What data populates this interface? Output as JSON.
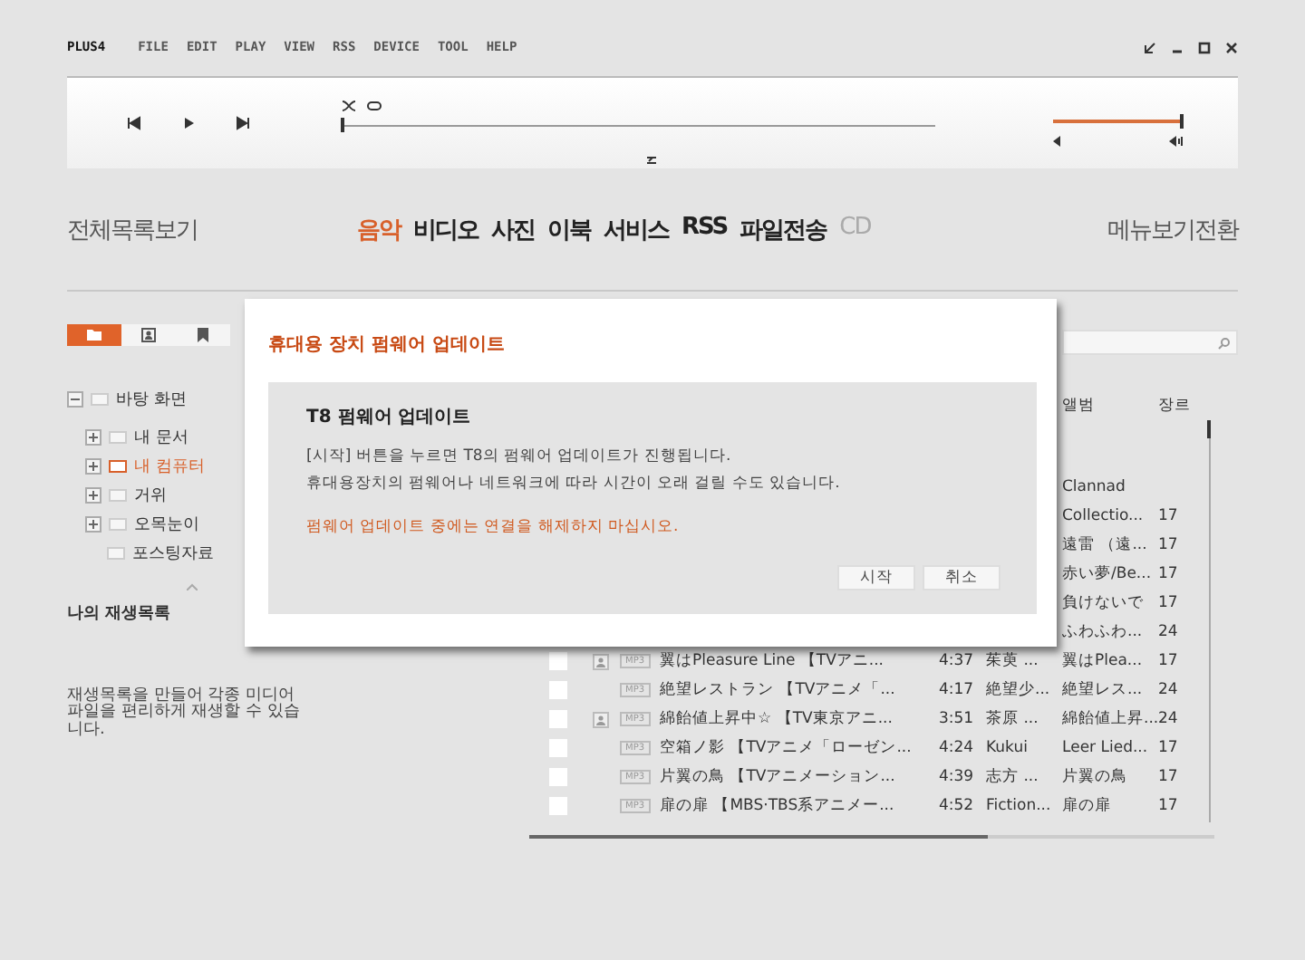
{
  "menu_bar": {
    "logo": "PLUS4",
    "items": [
      "FILE",
      "EDIT",
      "PLAY",
      "VIEW",
      "RSS",
      "DEVICE",
      "TOOL",
      "HELP"
    ]
  },
  "player": {
    "seek": {
      "level": 0
    },
    "volume": {
      "level": 1
    }
  },
  "nav": {
    "left": "전체목록보기",
    "right": "메뉴보기전환",
    "tabs": [
      {
        "label": "음악",
        "selected": true,
        "disabled": false
      },
      {
        "label": "비디오",
        "selected": false,
        "disabled": false
      },
      {
        "label": "사진",
        "selected": false,
        "disabled": false
      },
      {
        "label": "이북",
        "selected": false,
        "disabled": false
      },
      {
        "label": "서비스",
        "selected": false,
        "disabled": false
      },
      {
        "label": "RSS",
        "selected": false,
        "disabled": false
      },
      {
        "label": "파일전송",
        "selected": false,
        "disabled": false
      },
      {
        "label": "CD",
        "selected": false,
        "disabled": true
      }
    ]
  },
  "sidebar": {
    "tabs": [
      {
        "kind": "folder",
        "selected": true
      },
      {
        "kind": "contact",
        "selected": false
      },
      {
        "kind": "bookmark",
        "selected": false
      }
    ],
    "tree": [
      {
        "label": "바탕 화면",
        "expanded": true,
        "selected": false,
        "children": [
          {
            "label": "내 문서",
            "expanded": false,
            "selected": false
          },
          {
            "label": "내 컴퓨터",
            "expanded": false,
            "selected": true
          },
          {
            "label": "거위",
            "expanded": false,
            "selected": false
          },
          {
            "label": "오목눈이",
            "expanded": false,
            "selected": false
          },
          {
            "label": "포스팅자료",
            "selected": false
          }
        ]
      }
    ],
    "playlist_title": "나의 재생목록",
    "playlist_hint": "재생목록을 만들어 각종 미디어 파일을 편리하게 재생할 수 있습니다."
  },
  "table": {
    "columns": [
      "앨범",
      "장르"
    ],
    "rows": [
      {
        "album": "Clannad"
      },
      {
        "album": "Collectio...",
        "genre": "17"
      },
      {
        "album": "遠雷 （遠...",
        "genre": "17"
      },
      {
        "album": "赤い夢/Be...",
        "genre": "17"
      },
      {
        "album": "負けないで",
        "genre": "17"
      },
      {
        "album": "ふわふわ...",
        "genre": "24"
      },
      {
        "checked": false,
        "format": "MP3",
        "person_icon": true,
        "title": "翼はPleasure Line 【TVアニ...",
        "time": "4:37",
        "artist": "茱萸 ...",
        "album": "翼はPlea...",
        "genre": "17"
      },
      {
        "checked": false,
        "format": "MP3",
        "person_icon": false,
        "title": "絶望レストラン 【TVアニメ「...",
        "time": "4:17",
        "artist": "絶望少...",
        "album": "絶望レス...",
        "genre": "24"
      },
      {
        "checked": false,
        "format": "MP3",
        "person_icon": true,
        "title": "綿飴値上昇中☆ 【TV東京アニ...",
        "time": "3:51",
        "artist": "茶原 ...",
        "album": "綿飴値上昇...",
        "genre": "24"
      },
      {
        "checked": false,
        "format": "MP3",
        "person_icon": false,
        "title": "空箱ノ影 【TVアニメ「ローゼン...",
        "time": "4:24",
        "artist": "Kukui",
        "album": "Leer Lied...",
        "genre": "17"
      },
      {
        "checked": false,
        "format": "MP3",
        "person_icon": false,
        "title": "片翼の鳥 【TVアニメーション...",
        "time": "4:39",
        "artist": "志方 ...",
        "album": "片翼の鳥",
        "genre": "17"
      },
      {
        "checked": false,
        "format": "MP3",
        "person_icon": false,
        "title": "扉の扉 【MBS·TBS系アニメー...",
        "time": "4:52",
        "artist": "Fiction...",
        "album": "扉の扉",
        "genre": "17"
      }
    ]
  },
  "dialog": {
    "title": "휴대용 장치 펌웨어 업데이트",
    "heading": "T8 펌웨어 업데이트",
    "lines": [
      "[시작] 버튼을 누르면 T8의 펌웨어 업데이트가 진행됩니다.",
      "휴대용장치의 펌웨어나 네트워크에 따라 시간이 오래 걸릴 수도 있습니다."
    ],
    "warning": "펌웨어 업데이트 중에는 연결을 해제하지 마십시오.",
    "buttons": [
      "시작",
      "취소"
    ]
  }
}
